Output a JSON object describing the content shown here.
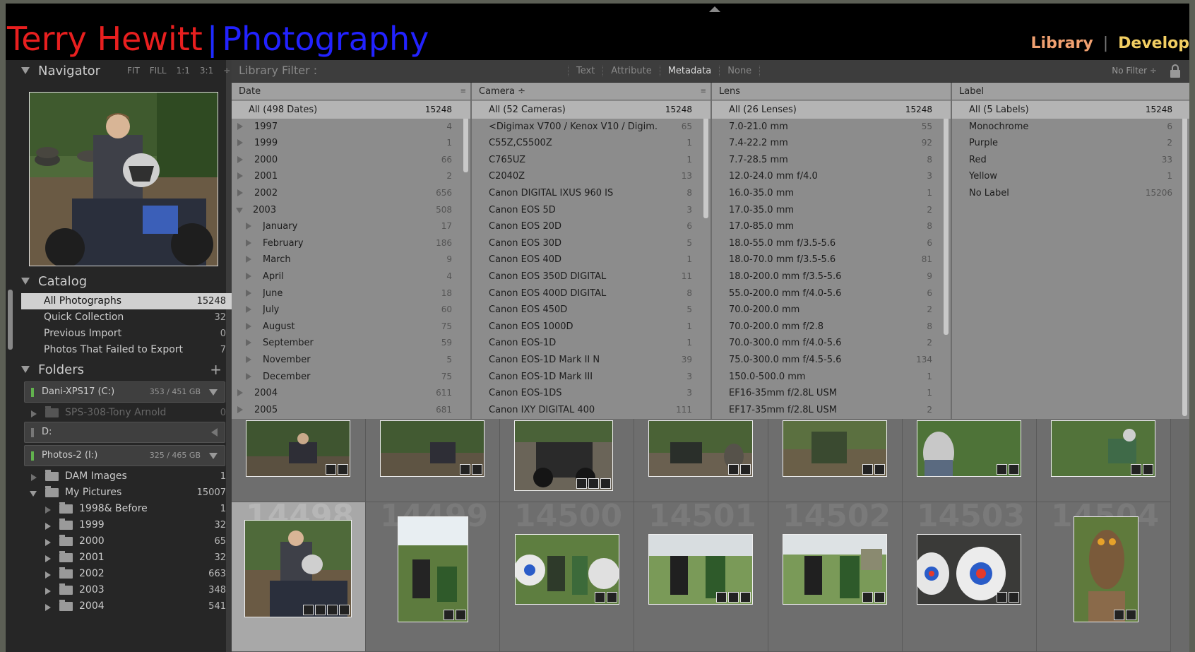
{
  "header": {
    "identity_name": "Terry Hewitt",
    "identity_sep": "|",
    "identity_photo": "Photography",
    "modules": [
      "Library",
      "Develop"
    ]
  },
  "navigator": {
    "title": "Navigator",
    "options": [
      "FIT",
      "FILL",
      "1:1",
      "3:1"
    ]
  },
  "catalog": {
    "title": "Catalog",
    "items": [
      {
        "label": "All Photographs",
        "count": "15248"
      },
      {
        "label": "Quick Collection",
        "count": "32"
      },
      {
        "label": "Previous Import",
        "count": "0"
      },
      {
        "label": "Photos That Failed to Export",
        "count": "7"
      }
    ]
  },
  "folders": {
    "title": "Folders",
    "add": "+",
    "vol1": {
      "label": "Dani-XPS17 (C:)",
      "size": "353 / 451 GB"
    },
    "vol1_child": {
      "label": "SPS-308-Tony Arnold",
      "count": "0"
    },
    "vol2": {
      "label": "D:"
    },
    "vol3": {
      "label": "Photos-2 (I:)",
      "size": "325 / 465 GB"
    },
    "items": [
      {
        "label": "DAM Images",
        "count": "1"
      },
      {
        "label": "My Pictures",
        "count": "15007"
      },
      {
        "label": "1998& Before",
        "count": "1"
      },
      {
        "label": "1999",
        "count": "32"
      },
      {
        "label": "2000",
        "count": "65"
      },
      {
        "label": "2001",
        "count": "32"
      },
      {
        "label": "2002",
        "count": "663"
      },
      {
        "label": "2003",
        "count": "348"
      },
      {
        "label": "2004",
        "count": "541"
      }
    ]
  },
  "filter": {
    "title": "Library Filter :",
    "tabs": [
      "Text",
      "Attribute",
      "Metadata",
      "None"
    ],
    "active": "Metadata",
    "preset": "No Filter ÷"
  },
  "columns": {
    "date": {
      "header": "Date",
      "rows": [
        {
          "label": "All (498 Dates)",
          "count": "15248"
        },
        {
          "label": "1997",
          "count": "4"
        },
        {
          "label": "1999",
          "count": "1"
        },
        {
          "label": "2000",
          "count": "66"
        },
        {
          "label": "2001",
          "count": "2"
        },
        {
          "label": "2002",
          "count": "656"
        },
        {
          "label": "2003",
          "count": "508"
        },
        {
          "label": "January",
          "count": "17"
        },
        {
          "label": "February",
          "count": "186"
        },
        {
          "label": "March",
          "count": "9"
        },
        {
          "label": "April",
          "count": "4"
        },
        {
          "label": "June",
          "count": "18"
        },
        {
          "label": "July",
          "count": "60"
        },
        {
          "label": "August",
          "count": "75"
        },
        {
          "label": "September",
          "count": "59"
        },
        {
          "label": "November",
          "count": "5"
        },
        {
          "label": "December",
          "count": "75"
        },
        {
          "label": "2004",
          "count": "611"
        },
        {
          "label": "2005",
          "count": "681"
        }
      ]
    },
    "camera": {
      "header": "Camera ÷",
      "rows": [
        {
          "label": "All (52 Cameras)",
          "count": "15248"
        },
        {
          "label": "<Digimax V700 / Kenox V10 / Digim...",
          "count": "65"
        },
        {
          "label": "C55Z,C5500Z",
          "count": "1"
        },
        {
          "label": "C765UZ",
          "count": "1"
        },
        {
          "label": "C2040Z",
          "count": "13"
        },
        {
          "label": "Canon DIGITAL IXUS 960 IS",
          "count": "8"
        },
        {
          "label": "Canon EOS 5D",
          "count": "3"
        },
        {
          "label": "Canon EOS 20D",
          "count": "6"
        },
        {
          "label": "Canon EOS 30D",
          "count": "5"
        },
        {
          "label": "Canon EOS 40D",
          "count": "1"
        },
        {
          "label": "Canon EOS 350D DIGITAL",
          "count": "11"
        },
        {
          "label": "Canon EOS 400D DIGITAL",
          "count": "8"
        },
        {
          "label": "Canon EOS 450D",
          "count": "5"
        },
        {
          "label": "Canon EOS 1000D",
          "count": "1"
        },
        {
          "label": "Canon EOS-1D",
          "count": "1"
        },
        {
          "label": "Canon EOS-1D Mark II N",
          "count": "39"
        },
        {
          "label": "Canon EOS-1D Mark III",
          "count": "3"
        },
        {
          "label": "Canon EOS-1DS",
          "count": "3"
        },
        {
          "label": "Canon IXY DIGITAL 400",
          "count": "111"
        }
      ]
    },
    "lens": {
      "header": "Lens",
      "rows": [
        {
          "label": "All (26 Lenses)",
          "count": "15248"
        },
        {
          "label": "7.0-21.0 mm",
          "count": "55"
        },
        {
          "label": "7.4-22.2 mm",
          "count": "92"
        },
        {
          "label": "7.7-28.5 mm",
          "count": "8"
        },
        {
          "label": "12.0-24.0 mm f/4.0",
          "count": "3"
        },
        {
          "label": "16.0-35.0 mm",
          "count": "1"
        },
        {
          "label": "17.0-35.0 mm",
          "count": "2"
        },
        {
          "label": "17.0-85.0 mm",
          "count": "8"
        },
        {
          "label": "18.0-55.0 mm f/3.5-5.6",
          "count": "6"
        },
        {
          "label": "18.0-70.0 mm f/3.5-5.6",
          "count": "81"
        },
        {
          "label": "18.0-200.0 mm f/3.5-5.6",
          "count": "9"
        },
        {
          "label": "55.0-200.0 mm f/4.0-5.6",
          "count": "6"
        },
        {
          "label": "70.0-200.0 mm",
          "count": "2"
        },
        {
          "label": "70.0-200.0 mm f/2.8",
          "count": "8"
        },
        {
          "label": "70.0-300.0 mm f/4.0-5.6",
          "count": "2"
        },
        {
          "label": "75.0-300.0 mm f/4.5-5.6",
          "count": "134"
        },
        {
          "label": "150.0-500.0 mm",
          "count": "1"
        },
        {
          "label": "EF16-35mm f/2.8L USM",
          "count": "1"
        },
        {
          "label": "EF17-35mm f/2.8L USM",
          "count": "2"
        }
      ]
    },
    "label": {
      "header": "Label",
      "rows": [
        {
          "label": "All (5 Labels)",
          "count": "15248"
        },
        {
          "label": "Monochrome",
          "count": "6"
        },
        {
          "label": "Purple",
          "count": "2"
        },
        {
          "label": "Red",
          "count": "33"
        },
        {
          "label": "Yellow",
          "count": "1"
        },
        {
          "label": "No Label",
          "count": "15206"
        }
      ]
    }
  },
  "grid": {
    "row2_numbers": [
      "14498",
      "14499",
      "14500",
      "14501",
      "14502",
      "14503",
      "14504"
    ]
  }
}
